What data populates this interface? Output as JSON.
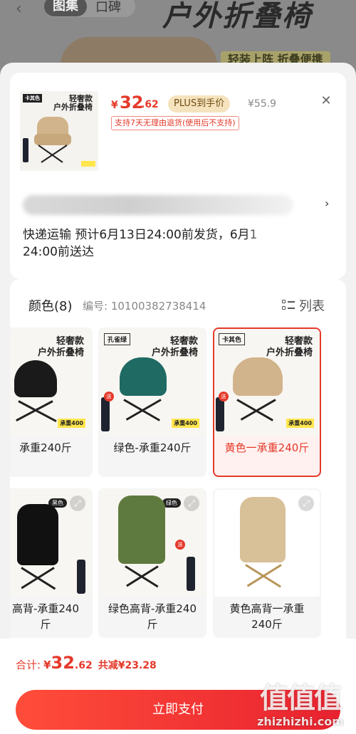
{
  "background_page": {
    "back_icon": "chevron-left-icon",
    "tabs": [
      "图集",
      "口碑"
    ],
    "title": "户外折叠椅",
    "slogan": "轻装上阵 折叠便携"
  },
  "product": {
    "thumb_tag": "卡其色",
    "thumb_title_1": "轻奢款",
    "thumb_title_2": "户外折叠椅",
    "price_currency": "¥",
    "price_int": "32",
    "price_dec": ".62",
    "plus_badge": "PLUS到手价",
    "original_price": "¥55.9",
    "return_note": "支持7天无理由退货(使用后不支持)",
    "close_icon": "close-icon"
  },
  "shipping": {
    "address_blurred": true,
    "chevron_icon": "chevron-right-icon",
    "text": "快递运输 预计6月13日24:00前发货，6月1 24:00前送达"
  },
  "spec": {
    "title": "颜色(8)",
    "code": "编号: 10100382738414",
    "list_label": "列表",
    "list_icon": "list-view-icon",
    "options": [
      {
        "label": "承重240斤",
        "img_title_1": "轻奢款",
        "img_title_2": "户外折叠椅",
        "weight": "承重400",
        "chair_color": "#1a1a1a"
      },
      {
        "label": "绿色-承重240斤",
        "img_title_1": "轻奢款",
        "img_title_2": "户外折叠椅",
        "brand": "孔雀绿",
        "weight": "承重400",
        "chair_color": "#1f6b64"
      },
      {
        "label": "黄色一承重240斤",
        "img_title_1": "轻奢款",
        "img_title_2": "户外折叠椅",
        "brand": "卡其色",
        "weight": "承重400",
        "chair_color": "#d2b48c",
        "selected": true
      },
      {
        "label": "高背-承重240斤",
        "color_badge": "黑色",
        "chair_color": "#111111"
      },
      {
        "label": "绿色高背-承重240斤",
        "color_badge": "绿色",
        "chair_color": "#5f7a3e"
      },
      {
        "label": "黄色高背一承重240斤",
        "chair_color": "#d8c098"
      }
    ]
  },
  "footer": {
    "total_label": "合计:",
    "total_currency": "¥",
    "total_int": "32",
    "total_dec": ".62",
    "total_save": "共减¥23.28",
    "pay_button": "立即支付"
  },
  "watermark": {
    "logo": "值值值",
    "url": "zhizhizhi.com"
  },
  "colors": {
    "accent": "#e5392a",
    "plus_badge_bg": "#f5e3bd",
    "selected_bg": "#fff1ef"
  }
}
